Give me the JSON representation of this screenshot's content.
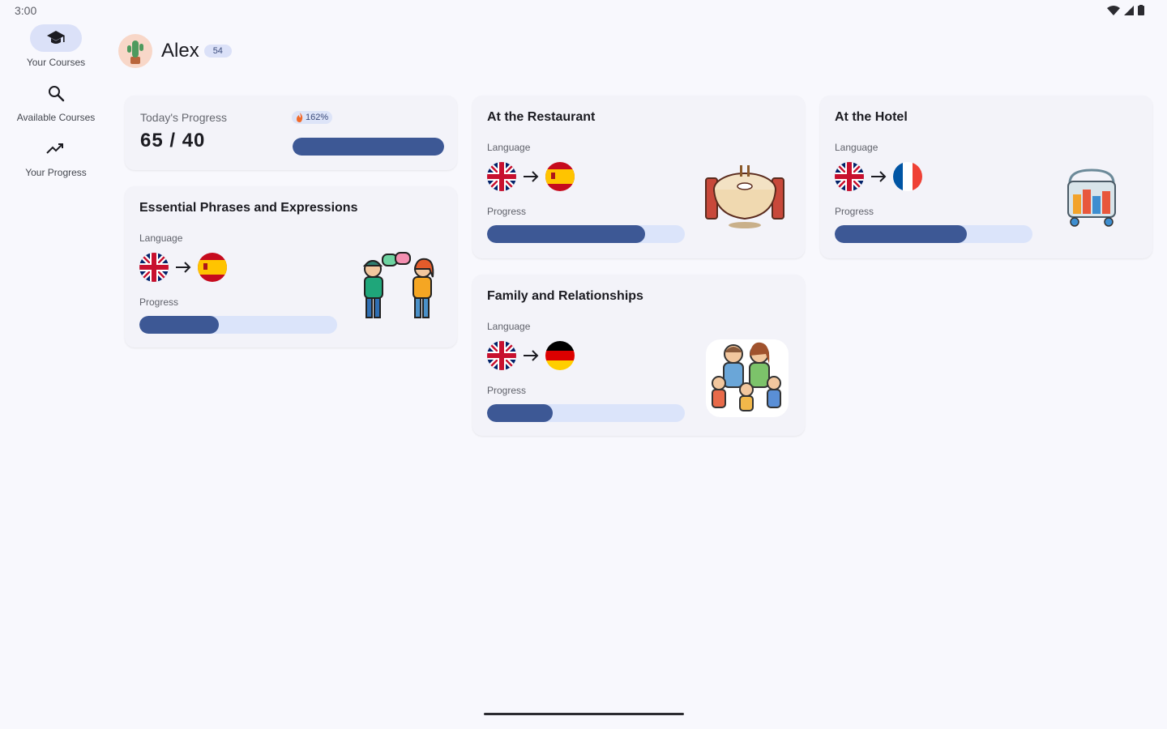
{
  "status_bar": {
    "time": "3:00"
  },
  "nav": {
    "items": [
      {
        "label": "Your Courses",
        "icon": "school-icon",
        "active": true
      },
      {
        "label": "Available Courses",
        "icon": "search-icon",
        "active": false
      },
      {
        "label": "Your Progress",
        "icon": "trending-up-icon",
        "active": false
      }
    ]
  },
  "user": {
    "name": "Alex",
    "level": "54"
  },
  "today": {
    "label": "Today's Progress",
    "value": "65 / 40",
    "streak": "162%",
    "progress": 1.0
  },
  "labels": {
    "language": "Language",
    "progress": "Progress"
  },
  "courses": [
    {
      "title": "Essential Phrases and Expressions",
      "from": "English (UK)",
      "to": "Spanish",
      "progress": 0.4,
      "illustration": "people-talking"
    },
    {
      "title": "At the Restaurant",
      "from": "English (UK)",
      "to": "Spanish",
      "progress": 0.8,
      "illustration": "restaurant-table"
    },
    {
      "title": "At the Hotel",
      "from": "English (UK)",
      "to": "French",
      "progress": 0.67,
      "illustration": "luggage-cart"
    },
    {
      "title": "Family and Relationships",
      "from": "English (UK)",
      "to": "German",
      "progress": 0.33,
      "illustration": "family"
    }
  ],
  "colors": {
    "accent": "#3d5895",
    "track": "#dbe4fa",
    "card": "#f3f3f9",
    "background": "#f8f8fd"
  }
}
